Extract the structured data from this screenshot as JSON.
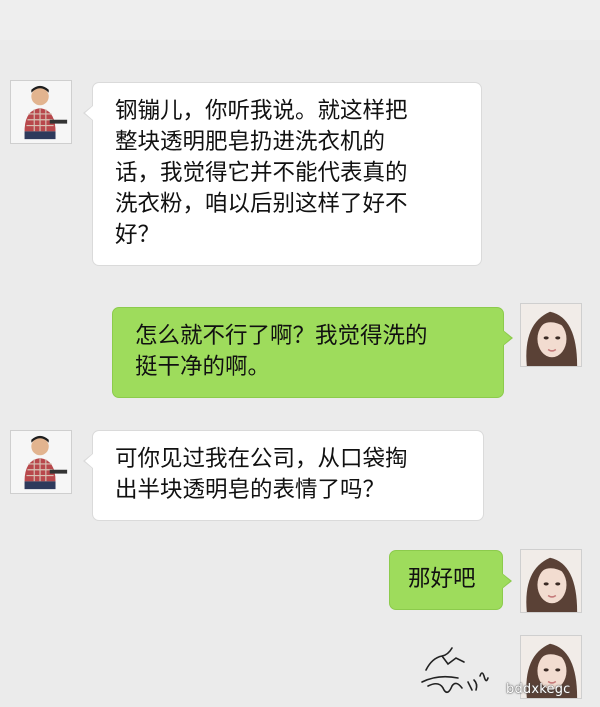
{
  "messages": [
    {
      "sender": "man",
      "text": "钢镚儿，你听我说。就这样把\n整块透明肥皂扔进洗衣机的\n话，我觉得它并不能代表真的\n洗衣粉，咱以后别这样了好不\n好？"
    },
    {
      "sender": "woman",
      "text": "怎么就不行了啊？我觉得洗的\n挺干净的啊。"
    },
    {
      "sender": "man",
      "text": "可你见过我在公司，从口袋掏\n出半块透明皂的表情了吗？"
    },
    {
      "sender": "woman",
      "text": "那好吧"
    }
  ],
  "watermark": "bddxkegc",
  "avatars": {
    "man": "man-in-plaid-shirt-avatar",
    "woman": "woman-face-avatar"
  },
  "colors": {
    "background": "#ebebeb",
    "incoming_bubble": "#ffffff",
    "outgoing_bubble": "#9edc5c"
  }
}
